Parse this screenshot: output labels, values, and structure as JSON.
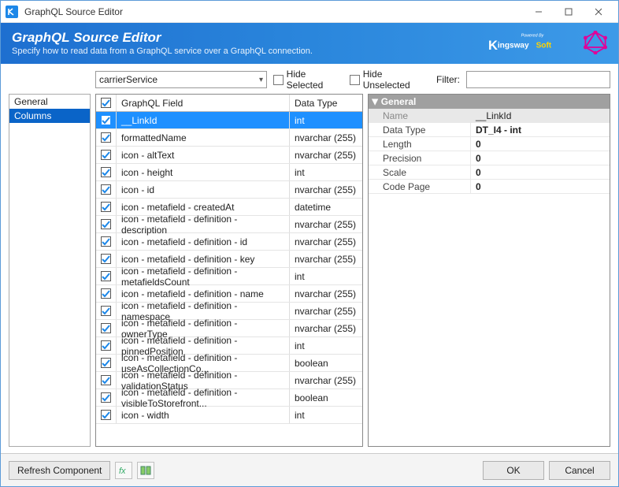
{
  "window": {
    "title": "GraphQL Source Editor"
  },
  "banner": {
    "heading": "GraphQL Source Editor",
    "subheading": "Specify how to read data from a GraphQL service over a GraphQL connection.",
    "powered_by": "Powered By",
    "brand": "KingswaySoft"
  },
  "leftnav": {
    "items": [
      "General",
      "Columns"
    ],
    "selected_index": 1
  },
  "controls": {
    "object_selector": "carrierService",
    "hide_selected_label": "Hide Selected",
    "hide_selected": false,
    "hide_unselected_label": "Hide Unselected",
    "hide_unselected": false,
    "filter_label": "Filter:",
    "filter_value": ""
  },
  "columns_table": {
    "headers": {
      "field": "GraphQL Field",
      "type": "Data Type"
    },
    "selected_row_index": 0,
    "rows": [
      {
        "checked": true,
        "field": "__LinkId",
        "type": "int"
      },
      {
        "checked": true,
        "field": "formattedName",
        "type": "nvarchar (255)"
      },
      {
        "checked": true,
        "field": "icon - altText",
        "type": "nvarchar (255)"
      },
      {
        "checked": true,
        "field": "icon - height",
        "type": "int"
      },
      {
        "checked": true,
        "field": "icon - id",
        "type": "nvarchar (255)"
      },
      {
        "checked": true,
        "field": "icon - metafield - createdAt",
        "type": "datetime"
      },
      {
        "checked": true,
        "field": "icon - metafield - definition - description",
        "type": "nvarchar (255)"
      },
      {
        "checked": true,
        "field": "icon - metafield - definition - id",
        "type": "nvarchar (255)"
      },
      {
        "checked": true,
        "field": "icon - metafield - definition - key",
        "type": "nvarchar (255)"
      },
      {
        "checked": true,
        "field": "icon - metafield - definition - metafieldsCount",
        "type": "int"
      },
      {
        "checked": true,
        "field": "icon - metafield - definition - name",
        "type": "nvarchar (255)"
      },
      {
        "checked": true,
        "field": "icon - metafield - definition - namespace",
        "type": "nvarchar (255)"
      },
      {
        "checked": true,
        "field": "icon - metafield - definition - ownerType",
        "type": "nvarchar (255)"
      },
      {
        "checked": true,
        "field": "icon - metafield - definition - pinnedPosition",
        "type": "int"
      },
      {
        "checked": true,
        "field": "icon - metafield - definition - useAsCollectionCo...",
        "type": "boolean"
      },
      {
        "checked": true,
        "field": "icon - metafield - definition - validationStatus",
        "type": "nvarchar (255)"
      },
      {
        "checked": true,
        "field": "icon - metafield - definition - visibleToStorefront...",
        "type": "boolean"
      },
      {
        "checked": true,
        "field": "icon - width",
        "type": "int"
      }
    ]
  },
  "properties": {
    "section": "General",
    "rows": [
      {
        "key": "Name",
        "value": "__LinkId",
        "dim": true
      },
      {
        "key": "Data Type",
        "value": "DT_I4 - int",
        "bold": true
      },
      {
        "key": "Length",
        "value": "0",
        "bold": true
      },
      {
        "key": "Precision",
        "value": "0",
        "bold": true
      },
      {
        "key": "Scale",
        "value": "0",
        "bold": true
      },
      {
        "key": "Code Page",
        "value": "0",
        "bold": true
      }
    ]
  },
  "footer": {
    "refresh": "Refresh Component",
    "ok": "OK",
    "cancel": "Cancel"
  }
}
